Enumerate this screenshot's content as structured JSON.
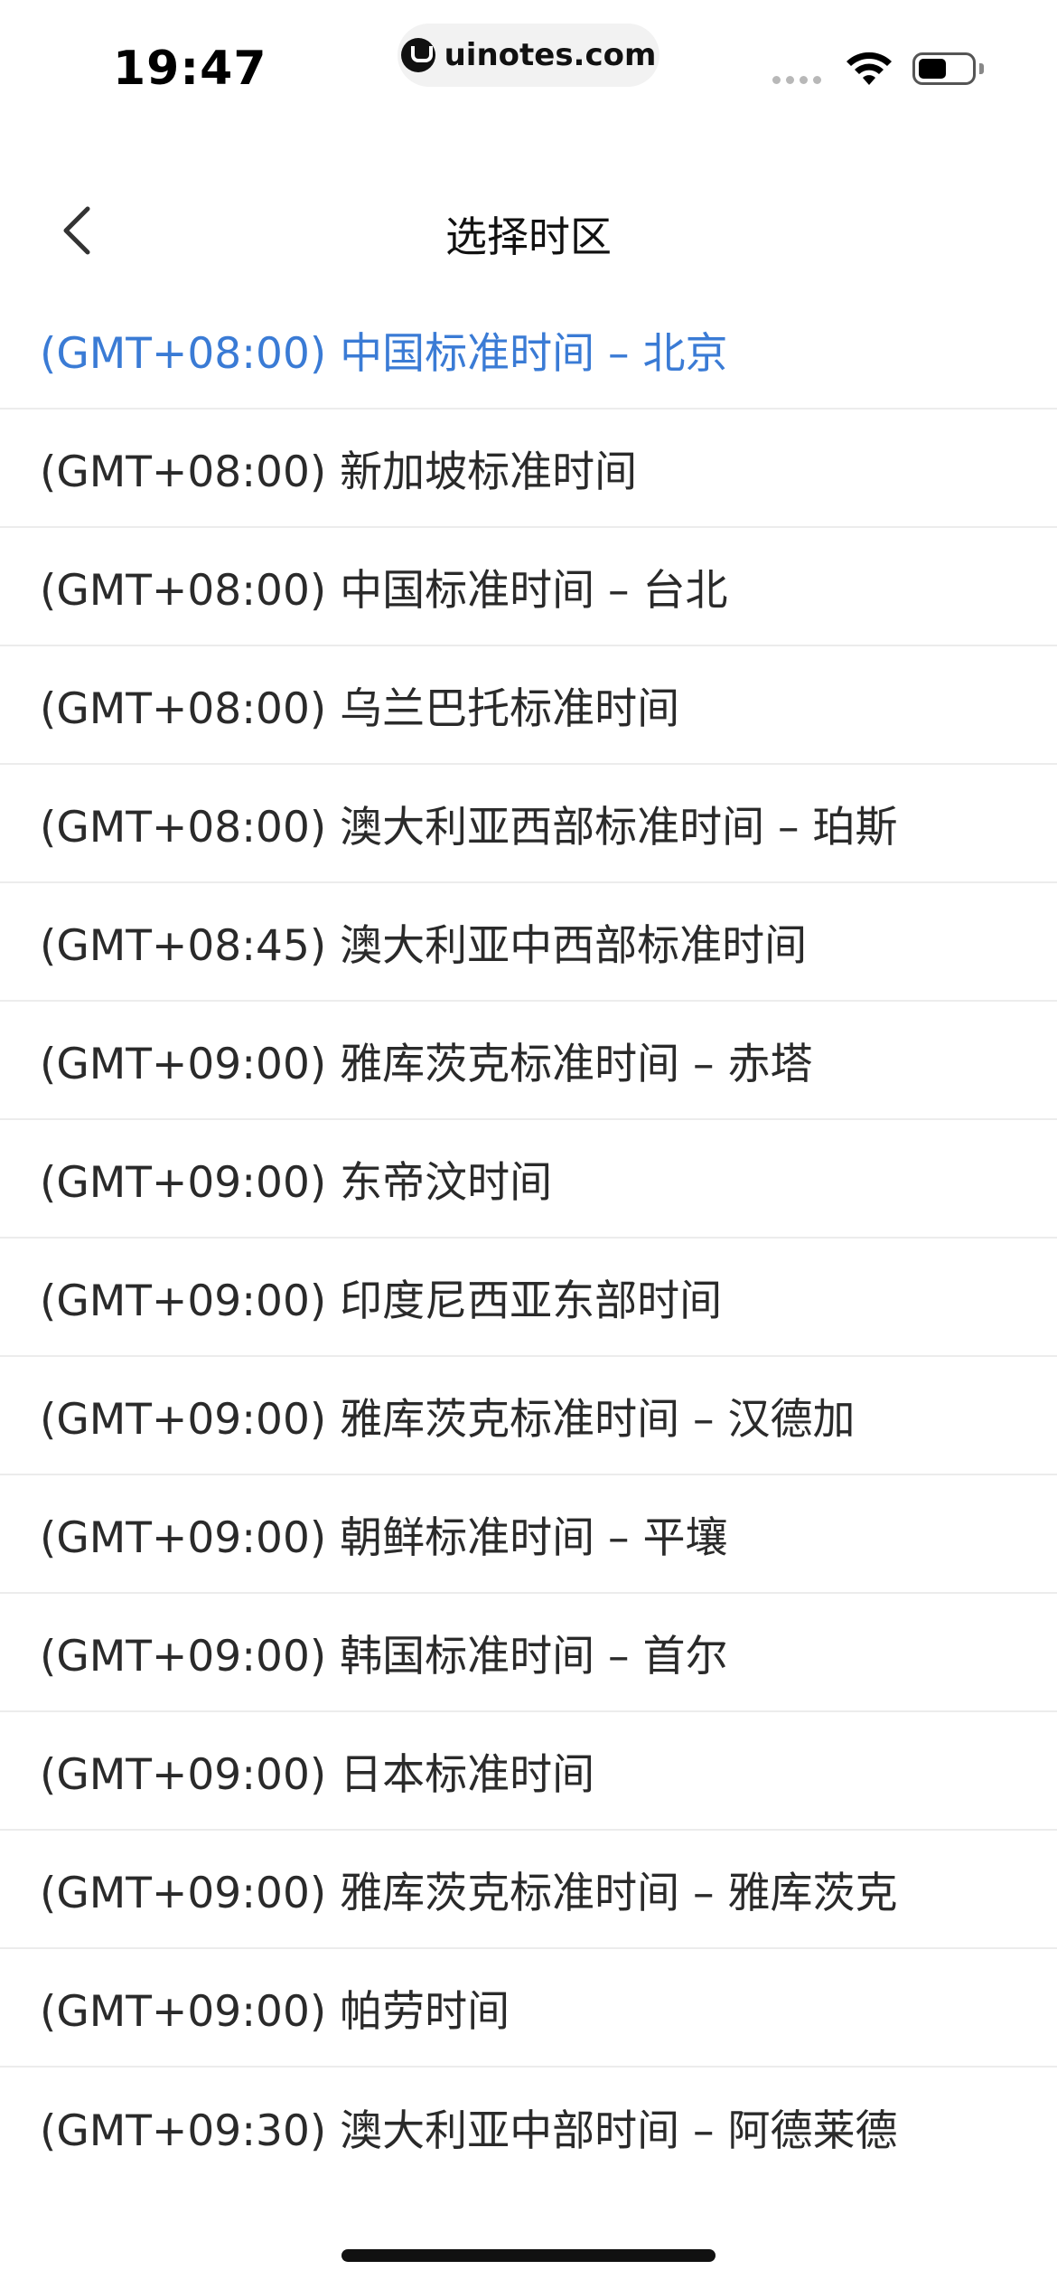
{
  "status_bar": {
    "time": "19:47",
    "url": "uinotes.com",
    "icons": [
      "cellular-signal-icon",
      "wifi-icon",
      "battery-icon"
    ]
  },
  "nav": {
    "title": "选择时区",
    "back_icon": "chevron-left-icon"
  },
  "colors": {
    "selected": "#3a7bd5",
    "text": "#2a2a2a",
    "divider": "#ececec"
  },
  "timezones": [
    {
      "label": "(GMT+08:00) 中国标准时间 – 北京",
      "selected": true
    },
    {
      "label": "(GMT+08:00) 新加坡标准时间",
      "selected": false
    },
    {
      "label": "(GMT+08:00) 中国标准时间 – 台北",
      "selected": false
    },
    {
      "label": "(GMT+08:00) 乌兰巴托标准时间",
      "selected": false
    },
    {
      "label": "(GMT+08:00) 澳大利亚西部标准时间 – 珀斯",
      "selected": false
    },
    {
      "label": "(GMT+08:45) 澳大利亚中西部标准时间",
      "selected": false
    },
    {
      "label": "(GMT+09:00) 雅库茨克标准时间 – 赤塔",
      "selected": false
    },
    {
      "label": "(GMT+09:00) 东帝汶时间",
      "selected": false
    },
    {
      "label": "(GMT+09:00) 印度尼西亚东部时间",
      "selected": false
    },
    {
      "label": "(GMT+09:00) 雅库茨克标准时间 – 汉德加",
      "selected": false
    },
    {
      "label": "(GMT+09:00) 朝鲜标准时间 – 平壤",
      "selected": false
    },
    {
      "label": "(GMT+09:00) 韩国标准时间 – 首尔",
      "selected": false
    },
    {
      "label": "(GMT+09:00) 日本标准时间",
      "selected": false
    },
    {
      "label": "(GMT+09:00) 雅库茨克标准时间 – 雅库茨克",
      "selected": false
    },
    {
      "label": "(GMT+09:00) 帕劳时间",
      "selected": false
    },
    {
      "label": "(GMT+09:30) 澳大利亚中部时间 – 阿德莱德",
      "selected": false
    }
  ]
}
